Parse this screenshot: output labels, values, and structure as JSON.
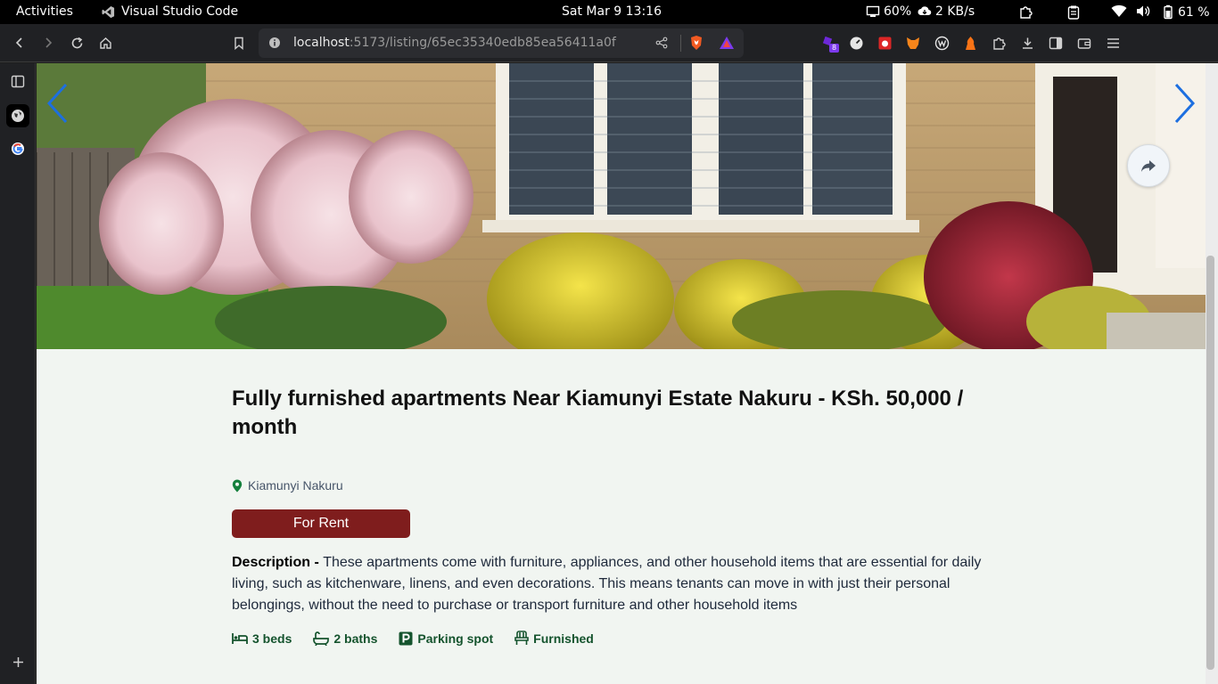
{
  "topbar": {
    "activities": "Activities",
    "app_name": "Visual Studio Code",
    "clock": "Sat Mar 9  13:16",
    "cpu": "60%",
    "net": "2 KB/s",
    "battery": "61 %"
  },
  "browser": {
    "url_host": "localhost",
    "url_path": ":5173/listing/65ec35340edb85ea56411a0f",
    "extension_badge": "8"
  },
  "listing": {
    "title": "Fully furnished apartments Near Kiamunyi Estate Nakuru - KSh. 50,000 / month",
    "location": "Kiamunyi Nakuru",
    "status": "For Rent",
    "description_label": "Description - ",
    "description": "These apartments come with furniture, appliances, and other household items that are essential for daily living, such as kitchenware, linens, and even decorations. This means tenants can move in with just their personal belongings, without the need to purchase or transport furniture and other household items",
    "features": {
      "beds": "3 beds",
      "baths": "2 baths",
      "parking": "Parking spot",
      "furnished": "Furnished"
    }
  },
  "colors": {
    "accent_red": "#7f1d1d",
    "feature_green": "#14532d",
    "arrow_blue": "#1d6fe0"
  }
}
